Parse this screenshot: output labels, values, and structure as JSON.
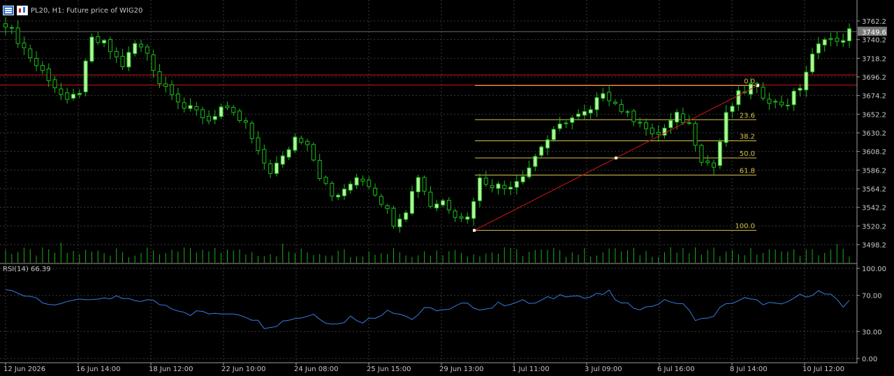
{
  "header": {
    "symbol_info": "PL20, H1:  Future price of WIG20"
  },
  "price_axis": {
    "ticks": [
      "3762.2",
      "3740.2",
      "3718.2",
      "3696.2",
      "3674.2",
      "3652.2",
      "3630.2",
      "3608.2",
      "3586.2",
      "3564.2",
      "3542.2",
      "3520.2",
      "3498.2"
    ],
    "current_price": "3749.6"
  },
  "rsi": {
    "label": "RSI(14) 66.39",
    "ticks": [
      "100.00",
      "70.00",
      "30.00",
      "0.00"
    ]
  },
  "time_axis": {
    "labels": [
      "12 Jun 2026",
      "16 Jun 14:00",
      "18 Jun 12:00",
      "22 Jun 10:00",
      "24 Jun 08:00",
      "25 Jun 15:00",
      "29 Jun 13:00",
      "1 Jul 11:00",
      "3 Jul 09:00",
      "6 Jul 16:00",
      "8 Jul 14:00",
      "10 Jul 12:00"
    ]
  },
  "fibonacci": {
    "levels": [
      "0.0",
      "23.6",
      "38.2",
      "50.0",
      "61.8",
      "100.0"
    ]
  },
  "colors": {
    "background": "#000000",
    "grid": "#3a3a3a",
    "bull_candle": "#b8f0a0",
    "bear_candle": "#000000",
    "candle_wick": "#19c019",
    "volume": "#19b019",
    "rsi_line": "#3a7be0",
    "fib_lines": "#d8c24a",
    "horizontal_lines": "#d01818",
    "trend_line": "#d01818"
  },
  "chart_data": {
    "type": "candlestick",
    "price_range": [
      3488,
      3770
    ],
    "rsi_range": [
      0,
      100
    ],
    "horizontal_levels": [
      3698.5,
      3686.5
    ],
    "fib_anchor_high": 3686.0,
    "fib_anchor_low": 3515.0,
    "close_path": [
      [
        0,
        3760
      ],
      [
        3,
        3730
      ],
      [
        5,
        3710
      ],
      [
        7,
        3695
      ],
      [
        10,
        3665
      ],
      [
        12,
        3680
      ],
      [
        14,
        3740
      ],
      [
        16,
        3735
      ],
      [
        19,
        3710
      ],
      [
        21,
        3735
      ],
      [
        23,
        3725
      ],
      [
        25,
        3690
      ],
      [
        27,
        3680
      ],
      [
        29,
        3660
      ],
      [
        31,
        3655
      ],
      [
        33,
        3645
      ],
      [
        35,
        3660
      ],
      [
        37,
        3650
      ],
      [
        39,
        3640
      ],
      [
        41,
        3605
      ],
      [
        43,
        3585
      ],
      [
        45,
        3600
      ],
      [
        47,
        3625
      ],
      [
        49,
        3620
      ],
      [
        51,
        3580
      ],
      [
        53,
        3555
      ],
      [
        55,
        3560
      ],
      [
        57,
        3580
      ],
      [
        59,
        3570
      ],
      [
        61,
        3550
      ],
      [
        63,
        3525
      ],
      [
        65,
        3540
      ],
      [
        67,
        3580
      ],
      [
        69,
        3545
      ],
      [
        71,
        3550
      ],
      [
        73,
        3535
      ],
      [
        75,
        3530
      ],
      [
        77,
        3575
      ],
      [
        79,
        3570
      ],
      [
        81,
        3565
      ],
      [
        83,
        3575
      ],
      [
        85,
        3590
      ],
      [
        87,
        3615
      ],
      [
        89,
        3630
      ],
      [
        91,
        3645
      ],
      [
        93,
        3650
      ],
      [
        95,
        3655
      ],
      [
        97,
        3680
      ],
      [
        99,
        3665
      ],
      [
        101,
        3650
      ],
      [
        103,
        3645
      ],
      [
        105,
        3625
      ],
      [
        107,
        3635
      ],
      [
        109,
        3650
      ],
      [
        111,
        3640
      ],
      [
        113,
        3600
      ],
      [
        115,
        3590
      ],
      [
        117,
        3650
      ],
      [
        119,
        3675
      ],
      [
        121,
        3685
      ],
      [
        123,
        3675
      ],
      [
        125,
        3665
      ],
      [
        127,
        3665
      ],
      [
        129,
        3685
      ],
      [
        131,
        3720
      ],
      [
        133,
        3745
      ],
      [
        135,
        3735
      ],
      [
        137,
        3750
      ]
    ],
    "rsi_path": [
      [
        0,
        76
      ],
      [
        4,
        70
      ],
      [
        7,
        62
      ],
      [
        9,
        58
      ],
      [
        11,
        66
      ],
      [
        13,
        67
      ],
      [
        15,
        63
      ],
      [
        18,
        68
      ],
      [
        20,
        64
      ],
      [
        22,
        65
      ],
      [
        24,
        63
      ],
      [
        26,
        59
      ],
      [
        28,
        55
      ],
      [
        30,
        50
      ],
      [
        32,
        52
      ],
      [
        34,
        48
      ],
      [
        36,
        51
      ],
      [
        38,
        50
      ],
      [
        40,
        45
      ],
      [
        42,
        36
      ],
      [
        44,
        38
      ],
      [
        46,
        44
      ],
      [
        48,
        46
      ],
      [
        50,
        49
      ],
      [
        52,
        42
      ],
      [
        54,
        38
      ],
      [
        56,
        46
      ],
      [
        58,
        42
      ],
      [
        60,
        45
      ],
      [
        62,
        55
      ],
      [
        64,
        50
      ],
      [
        66,
        44
      ],
      [
        68,
        54
      ],
      [
        70,
        55
      ],
      [
        72,
        53
      ],
      [
        74,
        60
      ],
      [
        76,
        58
      ],
      [
        78,
        55
      ],
      [
        80,
        60
      ],
      [
        82,
        62
      ],
      [
        84,
        63
      ],
      [
        86,
        61
      ],
      [
        88,
        66
      ],
      [
        90,
        70
      ],
      [
        92,
        72
      ],
      [
        94,
        67
      ],
      [
        96,
        70
      ],
      [
        98,
        73
      ],
      [
        100,
        60
      ],
      [
        102,
        58
      ],
      [
        104,
        56
      ],
      [
        106,
        62
      ],
      [
        108,
        64
      ],
      [
        110,
        59
      ],
      [
        112,
        45
      ],
      [
        114,
        43
      ],
      [
        116,
        55
      ],
      [
        118,
        63
      ],
      [
        120,
        66
      ],
      [
        122,
        63
      ],
      [
        124,
        61
      ],
      [
        126,
        58
      ],
      [
        128,
        67
      ],
      [
        130,
        71
      ],
      [
        132,
        74
      ],
      [
        134,
        69
      ],
      [
        136,
        57
      ],
      [
        137,
        66
      ]
    ]
  }
}
